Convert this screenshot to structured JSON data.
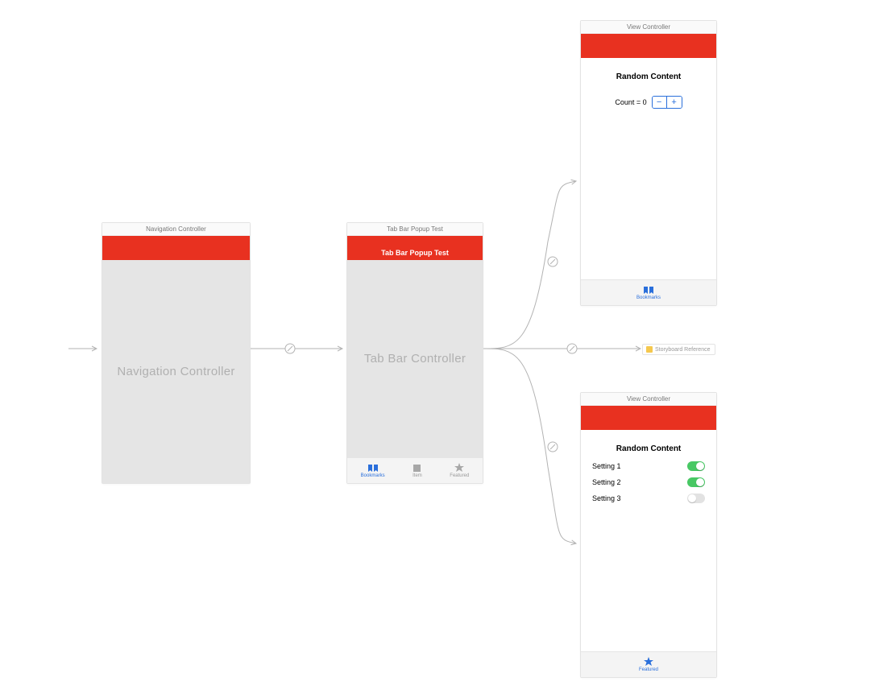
{
  "scenes": {
    "nav": {
      "title": "Navigation Controller",
      "body_label": "Navigation Controller"
    },
    "tabbar": {
      "title": "Tab Bar Popup Test",
      "nav_title": "Tab Bar Popup Test",
      "body_label": "Tab Bar Controller",
      "tabs": [
        {
          "label": "Bookmarks",
          "icon": "bookmarks-icon",
          "active": true
        },
        {
          "label": "Item",
          "icon": "square-icon",
          "active": false
        },
        {
          "label": "Featured",
          "icon": "star-icon",
          "active": false
        }
      ]
    },
    "vc1": {
      "title": "View Controller",
      "heading": "Random Content",
      "counter_label": "Count = 0",
      "tab": {
        "label": "Bookmarks",
        "icon": "bookmarks-icon"
      }
    },
    "sbref": {
      "label": "Storyboard Reference"
    },
    "vc2": {
      "title": "View Controller",
      "heading": "Random Content",
      "settings": [
        {
          "label": "Setting 1",
          "on": true
        },
        {
          "label": "Setting 2",
          "on": true
        },
        {
          "label": "Setting 3",
          "on": false
        }
      ],
      "tab": {
        "label": "Featured",
        "icon": "star-icon"
      }
    }
  },
  "colors": {
    "red": "#e83120",
    "blue": "#2a6fdb",
    "green": "#48c864"
  }
}
